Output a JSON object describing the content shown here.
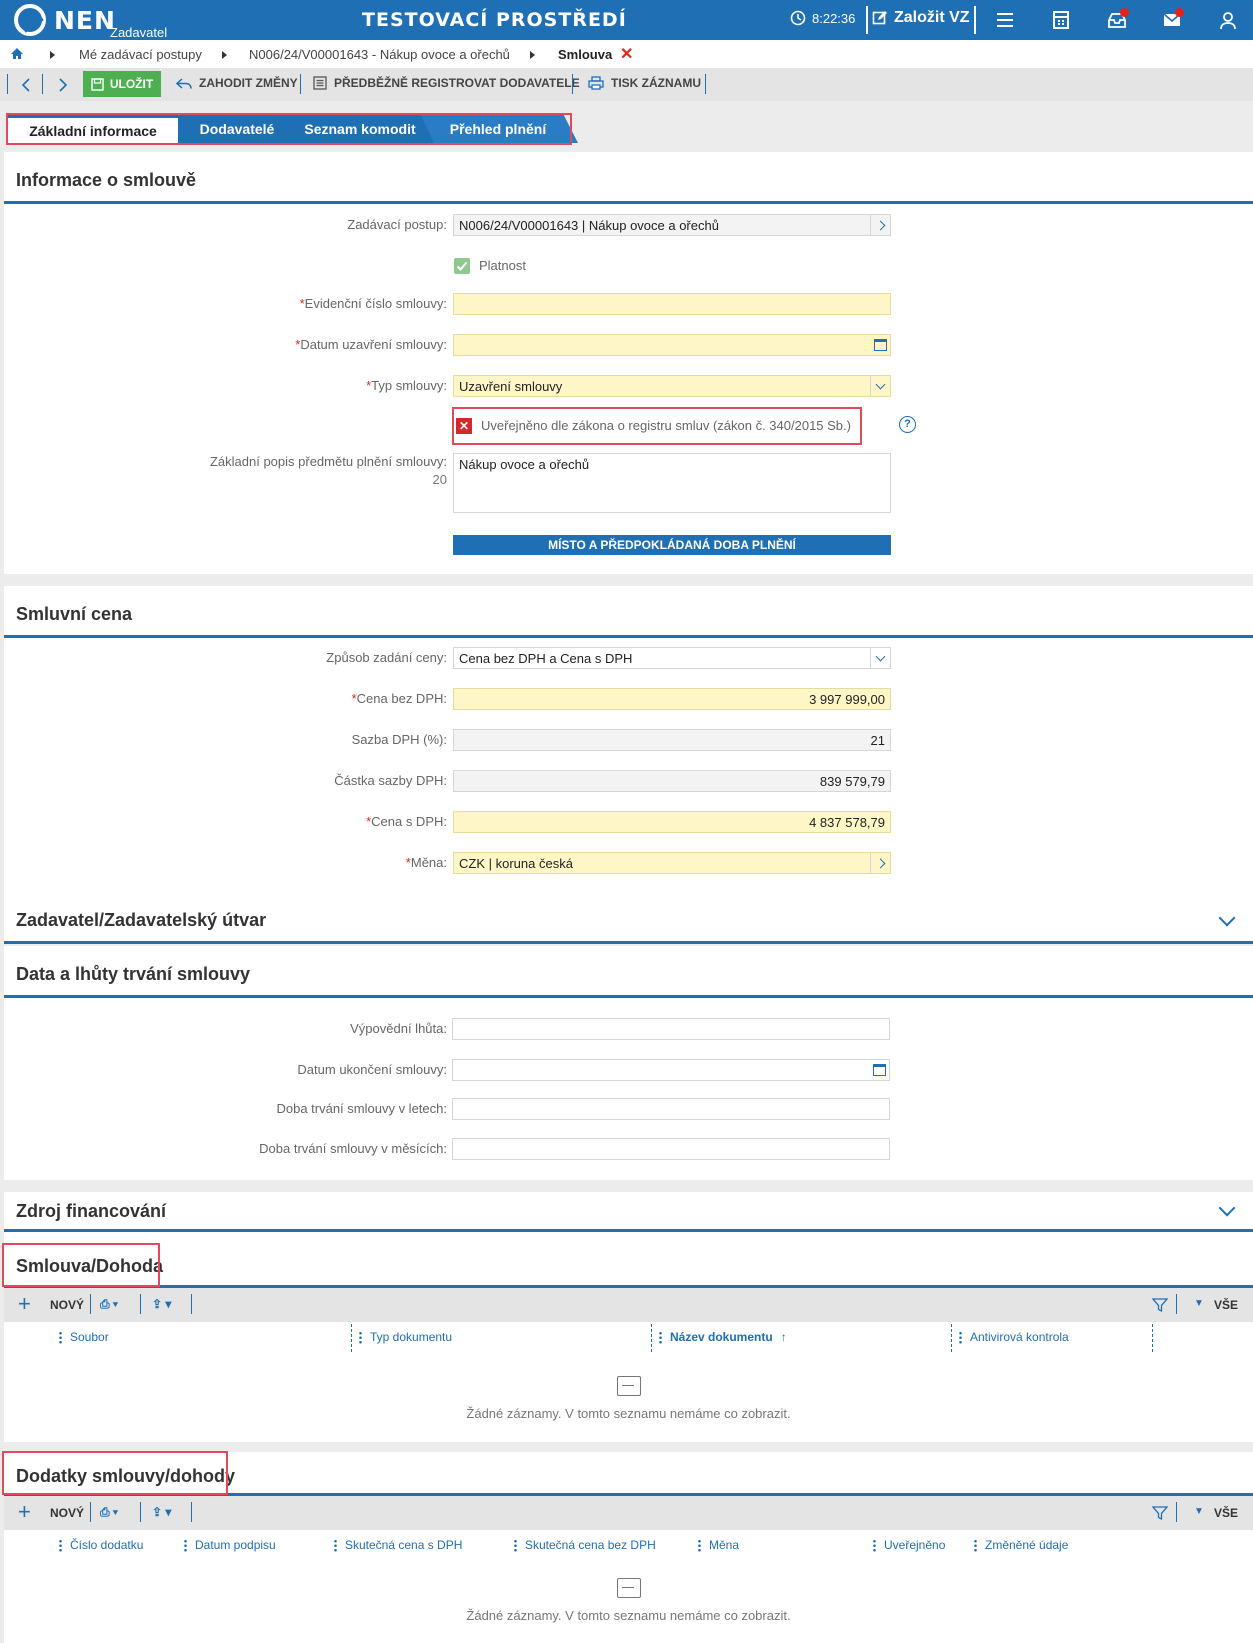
{
  "topbar": {
    "logo": "NEN",
    "logo_sub": "Zadavatel",
    "title": "TESTOVACÍ PROSTŘEDÍ",
    "time": "8:22:36",
    "create_label": "Založit VZ"
  },
  "breadcrumb": {
    "items": [
      "Mé zadávací postupy",
      "N006/24/V00001643 - Nákup ovoce a ořechů",
      "Smlouva"
    ]
  },
  "toolbar": {
    "save": "ULOŽIT",
    "discard": "ZAHODIT ZMĚNY",
    "preregister": "PŘEDBĚŽNĚ REGISTROVAT DODAVATELE",
    "print": "TISK ZÁZNAMU"
  },
  "tabs": [
    "Základní informace",
    "Dodavatelé",
    "Seznam komodit",
    "Přehled plnění"
  ],
  "info": {
    "title": "Informace o smlouvě",
    "procedure_label": "Zadávací postup:",
    "procedure_value": "N006/24/V00001643 | Nákup ovoce a ořechů",
    "validity_label": "Platnost",
    "contract_no_label": "Evidenční číslo smlouvy:",
    "contract_no_value": "",
    "date_label": "Datum uzavření smlouvy:",
    "date_value": "",
    "type_label": "Typ smlouvy:",
    "type_value": "Uzavření smlouvy",
    "published_label": "Uveřejněno dle zákona o registru smluv (zákon č. 340/2015 Sb.)",
    "desc_label": "Základní popis předmětu plnění smlouvy:",
    "desc_count": "20",
    "desc_value": "Nákup ovoce a ořechů",
    "place_button": "MÍSTO A PŘEDPOKLÁDANÁ DOBA PLNĚNÍ"
  },
  "price": {
    "title": "Smluvní cena",
    "method_label": "Způsob zadání ceny:",
    "method_value": "Cena bez DPH a Cena s DPH",
    "net_label": "Cena bez DPH:",
    "net_value": "3 997 999,00",
    "vat_rate_label": "Sazba DPH (%):",
    "vat_rate_value": "21",
    "vat_amount_label": "Částka sazby DPH:",
    "vat_amount_value": "839 579,79",
    "gross_label": "Cena s DPH:",
    "gross_value": "4 837 578,79",
    "currency_label": "Měna:",
    "currency_value": "CZK | koruna česká"
  },
  "contracting": {
    "title": "Zadavatel/Zadavatelský útvar"
  },
  "dates": {
    "title": "Data a lhůty trvání smlouvy",
    "notice_label": "Výpovědní lhůta:",
    "notice_value": "",
    "end_label": "Datum ukončení smlouvy:",
    "end_value": "",
    "years_label": "Doba trvání smlouvy v letech:",
    "years_value": "",
    "months_label": "Doba trvání smlouvy v měsících:",
    "months_value": ""
  },
  "funding": {
    "title": "Zdroj financování"
  },
  "contract_grid": {
    "title": "Smlouva/Dohoda",
    "new": "NOVÝ",
    "all": "VŠE",
    "columns": [
      "Soubor",
      "Typ dokumentu",
      "Název dokumentu",
      "Antivirová kontrola"
    ],
    "empty": "Žádné záznamy. V tomto seznamu nemáme co zobrazit."
  },
  "amendments_grid": {
    "title": "Dodatky smlouvy/dohody",
    "new": "NOVÝ",
    "all": "VŠE",
    "columns": [
      "Číslo dodatku",
      "Datum podpisu",
      "Skutečná cena s DPH",
      "Skutečná cena bez DPH",
      "Měna",
      "Uveřejněno",
      "Změněné údaje"
    ],
    "empty": "Žádné záznamy. V tomto seznamu nemáme co zobrazit."
  },
  "colors": {
    "primary": "#1f6fb5",
    "save_green": "#4caf50",
    "required_bg": "#fff6c8",
    "error_red": "#e2231a"
  }
}
